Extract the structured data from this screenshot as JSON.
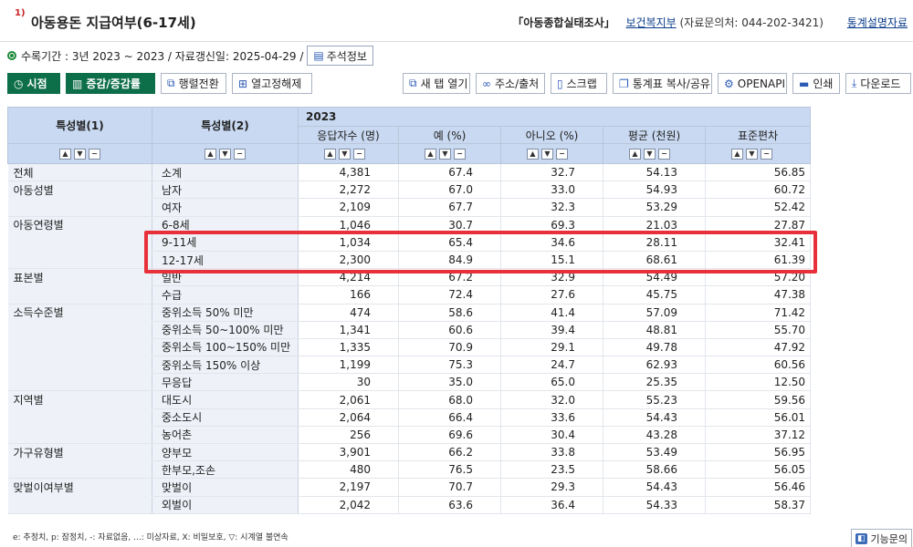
{
  "title": {
    "number": "1)",
    "text": "아동용돈 지급여부(6-17세)",
    "survey": "「아동종합실태조사」",
    "ministry": "보건복지부",
    "contact": "(자료문의처: 044-202-3421)",
    "stat_info": "통계설명자료"
  },
  "meta": {
    "period": "수록기간 : 3년 2023 ~ 2023 / 자료갱신일: 2025-04-29 /",
    "note_button": "주석정보"
  },
  "toolbar": {
    "view": "시점",
    "change": "증감/증감률",
    "transpose": "행렬전환",
    "unfix_columns": "열고정해제",
    "new_tab": "새 탭 열기",
    "address": "주소/출처",
    "scrap": "스크랩",
    "copy_share": "통계표 복사/공유",
    "openapi": "OPENAPI",
    "print": "인쇄",
    "download": "다운로드"
  },
  "table": {
    "col1_header": "특성별(1)",
    "col2_header": "특성별(2)",
    "year": "2023",
    "value_headers": [
      "응답자수 (명)",
      "예 (%)",
      "아니오 (%)",
      "평균 (천원)",
      "표준편차"
    ],
    "rows": [
      {
        "g": "전체",
        "s": "소계",
        "v": [
          "4,381",
          "67.4",
          "32.7",
          "54.13",
          "56.85"
        ]
      },
      {
        "g": "아동성별",
        "s": "남자",
        "v": [
          "2,272",
          "67.0",
          "33.0",
          "54.93",
          "60.72"
        ]
      },
      {
        "g": "",
        "s": "여자",
        "v": [
          "2,109",
          "67.7",
          "32.3",
          "53.29",
          "52.42"
        ]
      },
      {
        "g": "아동연령별",
        "s": "6-8세",
        "v": [
          "1,046",
          "30.7",
          "69.3",
          "21.03",
          "27.87"
        ]
      },
      {
        "g": "",
        "s": "9-11세",
        "v": [
          "1,034",
          "65.4",
          "34.6",
          "28.11",
          "32.41"
        ]
      },
      {
        "g": "",
        "s": "12-17세",
        "v": [
          "2,300",
          "84.9",
          "15.1",
          "68.61",
          "61.39"
        ]
      },
      {
        "g": "표본별",
        "s": "일반",
        "v": [
          "4,214",
          "67.2",
          "32.9",
          "54.49",
          "57.20"
        ]
      },
      {
        "g": "",
        "s": "수급",
        "v": [
          "166",
          "72.4",
          "27.6",
          "45.75",
          "47.38"
        ]
      },
      {
        "g": "소득수준별",
        "s": "중위소득 50% 미만",
        "v": [
          "474",
          "58.6",
          "41.4",
          "57.09",
          "71.42"
        ]
      },
      {
        "g": "",
        "s": "중위소득 50~100% 미만",
        "v": [
          "1,341",
          "60.6",
          "39.4",
          "48.81",
          "55.70"
        ]
      },
      {
        "g": "",
        "s": "중위소득 100~150% 미만",
        "v": [
          "1,335",
          "70.9",
          "29.1",
          "49.78",
          "47.92"
        ]
      },
      {
        "g": "",
        "s": "중위소득 150% 이상",
        "v": [
          "1,199",
          "75.3",
          "24.7",
          "62.93",
          "60.56"
        ]
      },
      {
        "g": "",
        "s": "무응답",
        "v": [
          "30",
          "35.0",
          "65.0",
          "25.35",
          "12.50"
        ]
      },
      {
        "g": "지역별",
        "s": "대도시",
        "v": [
          "2,061",
          "68.0",
          "32.0",
          "55.23",
          "59.56"
        ]
      },
      {
        "g": "",
        "s": "중소도시",
        "v": [
          "2,064",
          "66.4",
          "33.6",
          "54.43",
          "56.01"
        ]
      },
      {
        "g": "",
        "s": "농어촌",
        "v": [
          "256",
          "69.6",
          "30.4",
          "43.28",
          "37.12"
        ]
      },
      {
        "g": "가구유형별",
        "s": "양부모",
        "v": [
          "3,901",
          "66.2",
          "33.8",
          "53.49",
          "56.95"
        ]
      },
      {
        "g": "",
        "s": "한부모,조손",
        "v": [
          "480",
          "76.5",
          "23.5",
          "58.66",
          "56.05"
        ]
      },
      {
        "g": "맞벌이여부별",
        "s": "맞벌이",
        "v": [
          "2,197",
          "70.7",
          "29.3",
          "54.43",
          "56.46"
        ]
      },
      {
        "g": "",
        "s": "외벌이",
        "v": [
          "2,042",
          "63.6",
          "36.4",
          "54.33",
          "58.37"
        ]
      }
    ]
  },
  "footer": {
    "legend": "e: 추정치, p: 잠정치, -: 자료없음, ...: 미상자료, X: 비밀보호, ▽: 시계열 불연속",
    "function_button": "기능문의"
  },
  "colors": {
    "header_bg": "#c9d9f1",
    "row_label_bg": "#eef2f8",
    "accent_green": "#0d6e4a",
    "highlight_red": "#e8303a",
    "link_blue": "#0b3c8a"
  }
}
